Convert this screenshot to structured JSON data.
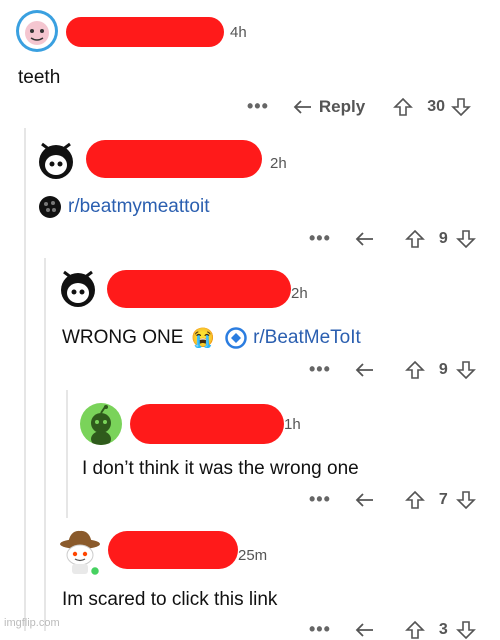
{
  "comments": [
    {
      "time": "4h",
      "body": "teeth",
      "reply_label": "Reply",
      "score": "30"
    },
    {
      "time": "2h",
      "link_text": "r/beatmymeattoit",
      "score": "9"
    },
    {
      "time": "2h",
      "body": "WRONG ONE",
      "emoji": "😭",
      "link_text": "r/BeatMeToIt",
      "score": "9"
    },
    {
      "time": "1h",
      "body": "I don’t think it was the wrong one",
      "score": "7"
    },
    {
      "time": "25m",
      "body": "Im scared to click this link",
      "score": "3"
    }
  ],
  "more_icon": "•••",
  "watermark": "imgflip.com"
}
